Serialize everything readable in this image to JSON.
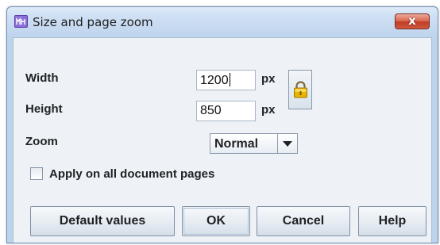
{
  "window": {
    "title": "Size and page zoom",
    "close_label": "x"
  },
  "form": {
    "width_label": "Width",
    "width_value": "1200",
    "width_unit": "px",
    "height_label": "Height",
    "height_value": "850",
    "height_unit": "px",
    "zoom_label": "Zoom",
    "zoom_value": "Normal",
    "apply_all_label": "Apply on all document pages",
    "apply_all_checked": false
  },
  "buttons": {
    "default_values": "Default values",
    "ok": "OK",
    "cancel": "Cancel",
    "help": "Help"
  },
  "icons": {
    "app": "app-icon",
    "lock": "lock-icon",
    "dropdown": "chevron-down-icon"
  },
  "colors": {
    "titlebar": "#c3d7ef",
    "client_bg": "#eef2f6",
    "close_button": "#c13c27",
    "lock_gold": "#e8b400"
  }
}
